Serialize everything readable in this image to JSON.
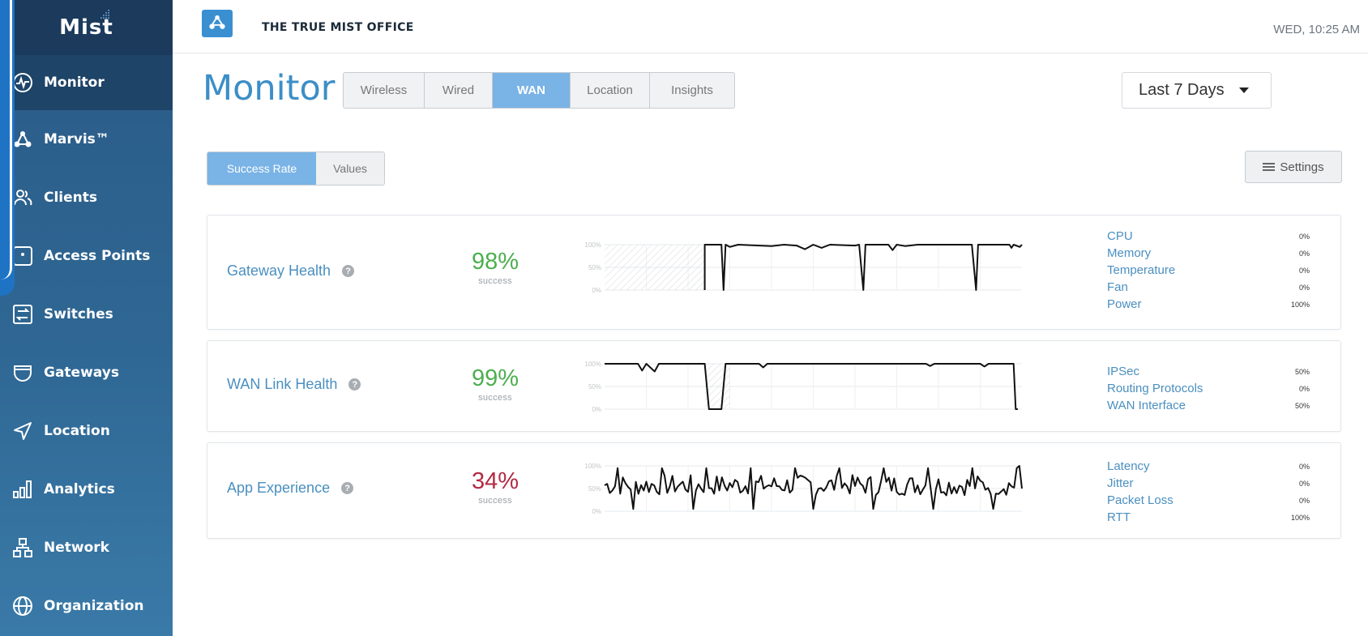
{
  "brand": {
    "logo": "Mist"
  },
  "sidebar": {
    "items": [
      {
        "label": "Monitor",
        "icon": "pulse-icon",
        "active": true
      },
      {
        "label": "Marvis™",
        "icon": "marvis-icon",
        "active": false
      },
      {
        "label": "Clients",
        "icon": "clients-icon",
        "active": false
      },
      {
        "label": "Access Points",
        "icon": "access-point-icon",
        "active": false
      },
      {
        "label": "Switches",
        "icon": "switch-icon",
        "active": false
      },
      {
        "label": "Gateways",
        "icon": "gateway-icon",
        "active": false
      },
      {
        "label": "Location",
        "icon": "location-icon",
        "active": false
      },
      {
        "label": "Analytics",
        "icon": "analytics-icon",
        "active": false
      },
      {
        "label": "Network",
        "icon": "network-icon",
        "active": false
      },
      {
        "label": "Organization",
        "icon": "globe-icon",
        "active": false
      }
    ]
  },
  "header": {
    "site_name": "THE TRUE MIST OFFICE",
    "clock": "WED, 10:25 AM"
  },
  "page": {
    "title": "Monitor",
    "view_tabs": [
      {
        "label": "Wireless",
        "active": false
      },
      {
        "label": "Wired",
        "active": false
      },
      {
        "label": "WAN",
        "active": true
      },
      {
        "label": "Location",
        "active": false
      },
      {
        "label": "Insights",
        "active": false
      }
    ],
    "time_range": "Last 7 Days",
    "metric_tabs": [
      {
        "label": "Success Rate",
        "active": true
      },
      {
        "label": "Values",
        "active": false
      }
    ],
    "settings_label": "Settings"
  },
  "cards": [
    {
      "name": "Gateway Health",
      "percent": "98%",
      "percent_label": "success",
      "percent_color": "#4caf50",
      "chart": {
        "y_ticks": [
          "100%",
          "50%",
          "0%"
        ],
        "no_data_span": [
          0,
          0.24
        ],
        "points": [
          [
            0.24,
            0
          ],
          [
            0.24,
            1
          ],
          [
            0.28,
            1
          ],
          [
            0.285,
            0
          ],
          [
            0.29,
            1
          ],
          [
            0.3,
            0.95
          ],
          [
            0.32,
            1
          ],
          [
            0.4,
            0.97
          ],
          [
            0.43,
            1
          ],
          [
            0.46,
            0.98
          ],
          [
            0.48,
            0.9
          ],
          [
            0.5,
            1
          ],
          [
            0.52,
            0.93
          ],
          [
            0.54,
            1
          ],
          [
            0.6,
            0.98
          ],
          [
            0.61,
            1
          ],
          [
            0.62,
            0
          ],
          [
            0.625,
            1
          ],
          [
            0.68,
            1
          ],
          [
            0.69,
            0.88
          ],
          [
            0.7,
            1
          ],
          [
            0.72,
            0.97
          ],
          [
            0.75,
            1
          ],
          [
            0.88,
            1
          ],
          [
            0.89,
            0
          ],
          [
            0.895,
            1
          ],
          [
            0.97,
            1
          ],
          [
            0.975,
            0.93
          ],
          [
            0.98,
            1
          ],
          [
            0.995,
            0.95
          ],
          [
            1,
            1
          ]
        ]
      },
      "factors": [
        {
          "name": "CPU",
          "value": "0%"
        },
        {
          "name": "Memory",
          "value": "0%"
        },
        {
          "name": "Temperature",
          "value": "0%"
        },
        {
          "name": "Fan",
          "value": "0%"
        },
        {
          "name": "Power",
          "value": "100%"
        }
      ]
    },
    {
      "name": "WAN Link Health",
      "percent": "99%",
      "percent_label": "success",
      "percent_color": "#4caf50",
      "chart": {
        "y_ticks": [
          "100%",
          "50%",
          "0%"
        ],
        "no_data_span": [
          0.24,
          0.3
        ],
        "points": [
          [
            0,
            1
          ],
          [
            0.08,
            1
          ],
          [
            0.09,
            0.85
          ],
          [
            0.1,
            1
          ],
          [
            0.12,
            0.83
          ],
          [
            0.13,
            1
          ],
          [
            0.24,
            1
          ],
          [
            0.25,
            0
          ],
          [
            0.26,
            0
          ],
          [
            0.28,
            0
          ],
          [
            0.29,
            1
          ],
          [
            0.37,
            1
          ],
          [
            0.38,
            0.92
          ],
          [
            0.39,
            1
          ],
          [
            0.77,
            1
          ],
          [
            0.78,
            0.95
          ],
          [
            0.79,
            1
          ],
          [
            0.9,
            1
          ],
          [
            0.91,
            0.94
          ],
          [
            0.92,
            1
          ],
          [
            0.98,
            1
          ],
          [
            0.985,
            0
          ],
          [
            0.99,
            0
          ]
        ]
      },
      "factors": [
        {
          "name": "IPSec",
          "value": "50%"
        },
        {
          "name": "Routing Protocols",
          "value": "0%"
        },
        {
          "name": "WAN Interface",
          "value": "50%"
        }
      ]
    },
    {
      "name": "App Experience",
      "percent": "34%",
      "percent_label": "success",
      "percent_color": "#b32a44",
      "chart": {
        "y_ticks": [
          "100%",
          "50%",
          "0%"
        ],
        "no_data_span": null,
        "points": "noisy"
      },
      "factors": [
        {
          "name": "Latency",
          "value": "0%"
        },
        {
          "name": "Jitter",
          "value": "0%"
        },
        {
          "name": "Packet Loss",
          "value": "0%"
        },
        {
          "name": "RTT",
          "value": "100%"
        }
      ]
    }
  ]
}
